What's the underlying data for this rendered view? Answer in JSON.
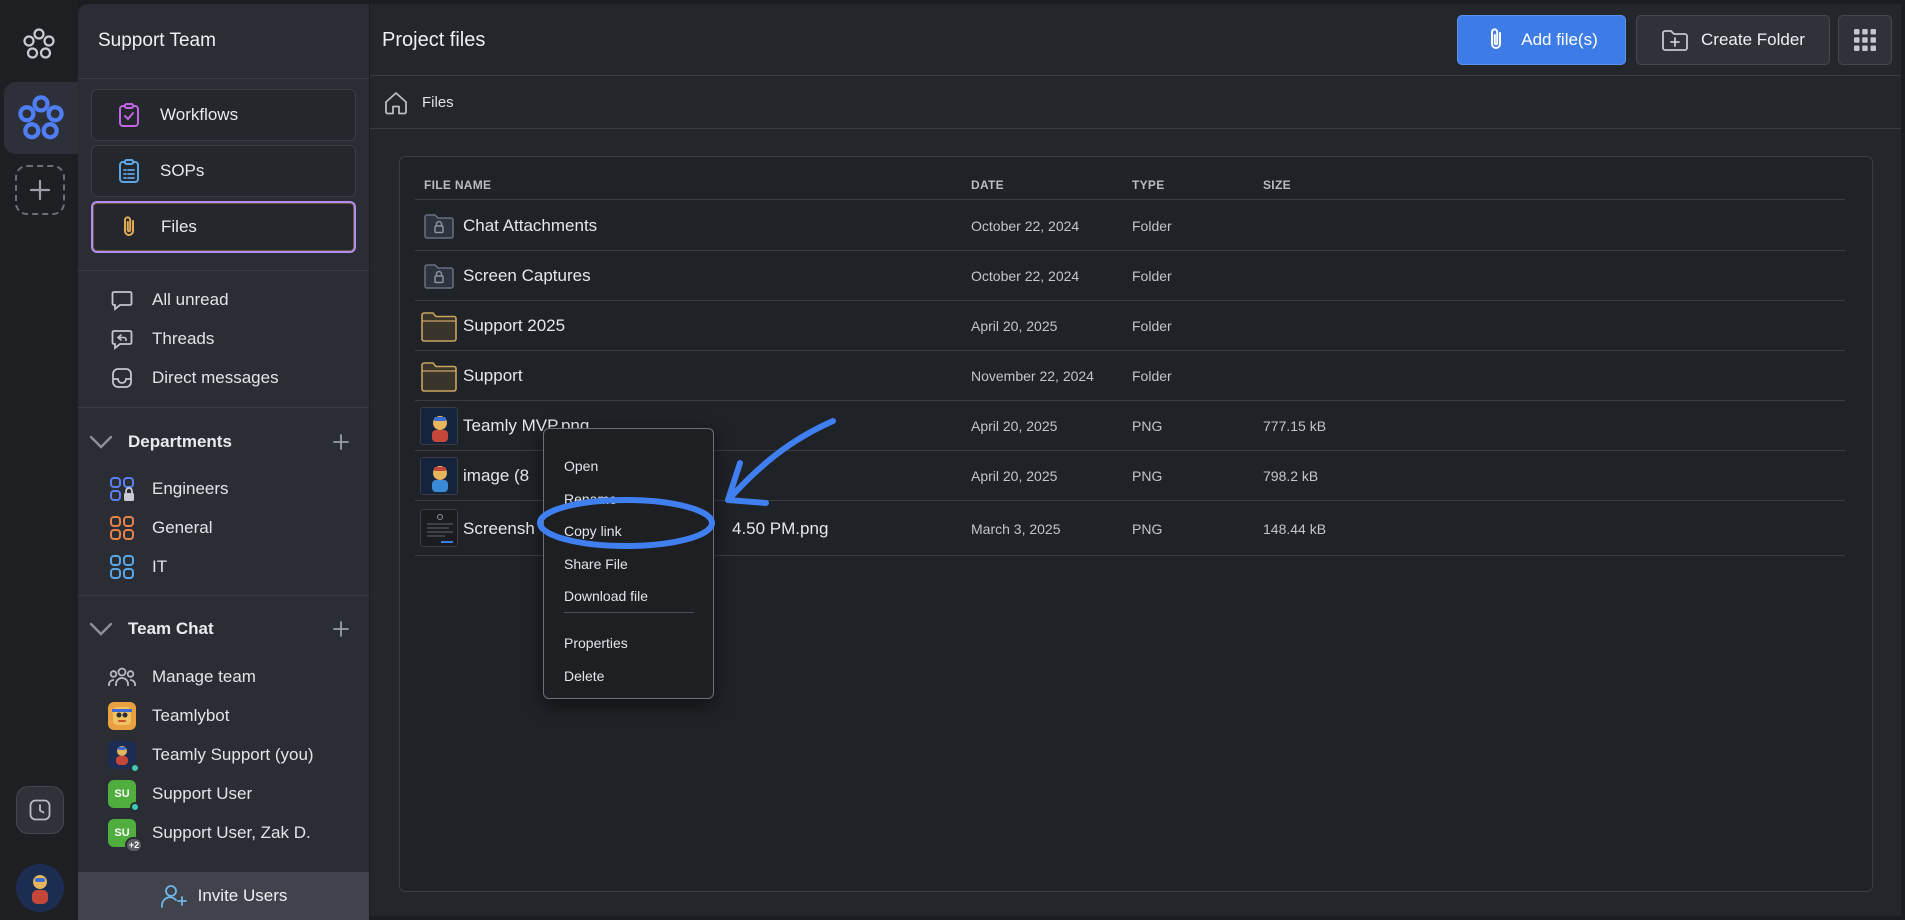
{
  "sidebar": {
    "team_name": "Support Team",
    "nav": [
      {
        "label": "Workflows",
        "icon": "clipboard-check-icon"
      },
      {
        "label": "SOPs",
        "icon": "clipboard-list-icon"
      },
      {
        "label": "Files",
        "icon": "paperclip-icon"
      }
    ],
    "quick": [
      {
        "label": "All unread",
        "icon": "chat-bubble-icon"
      },
      {
        "label": "Threads",
        "icon": "threads-icon"
      },
      {
        "label": "Direct messages",
        "icon": "inbox-icon"
      }
    ],
    "departments": {
      "title": "Departments",
      "items": [
        {
          "label": "Engineers",
          "icon": "department-locked-icon",
          "color": "#5b7ff0"
        },
        {
          "label": "General",
          "icon": "department-icon",
          "color": "#e8824a"
        },
        {
          "label": "IT",
          "icon": "department-icon",
          "color": "#5aa7e8"
        }
      ]
    },
    "team_chat": {
      "title": "Team Chat",
      "items": [
        {
          "label": "Manage team",
          "icon": "people-icon"
        },
        {
          "label": "Teamlybot",
          "icon": "bot-avatar"
        },
        {
          "label": "Teamly Support (you)",
          "icon": "support-avatar"
        },
        {
          "label": "Support User",
          "initials": "SU"
        },
        {
          "label": "Support User, Zak D.",
          "initials": "SU",
          "extra": "+2"
        }
      ]
    },
    "invite_label": "Invite Users"
  },
  "header": {
    "title": "Project files",
    "add_files_label": "Add file(s)",
    "create_folder_label": "Create Folder"
  },
  "breadcrumb": {
    "current": "Files"
  },
  "table": {
    "columns": {
      "name": "FILE NAME",
      "date": "DATE",
      "type": "TYPE",
      "size": "SIZE"
    },
    "rows": [
      {
        "name": "Chat Attachments",
        "date": "October 22, 2024",
        "type": "Folder",
        "size": "",
        "icon": "locked-folder-icon"
      },
      {
        "name": "Screen Captures",
        "date": "October 22, 2024",
        "type": "Folder",
        "size": "",
        "icon": "locked-folder-icon"
      },
      {
        "name": "Support 2025",
        "date": "April 20, 2025",
        "type": "Folder",
        "size": "",
        "icon": "folder-icon"
      },
      {
        "name": "Support",
        "date": "November 22, 2024",
        "type": "Folder",
        "size": "",
        "icon": "folder-icon"
      },
      {
        "name": "Teamly MVP.png",
        "date": "April 20, 2025",
        "type": "PNG",
        "size": "777.15 kB",
        "icon": "image-thumbnail"
      },
      {
        "name": "image (8",
        "date": "April 20, 2025",
        "type": "PNG",
        "size": "798.2 kB",
        "icon": "image-thumbnail"
      },
      {
        "name": "Screensh",
        "name_tail": "4.50 PM.png",
        "date": "March 3, 2025",
        "type": "PNG",
        "size": "148.44 kB",
        "icon": "screenshot-thumbnail"
      }
    ]
  },
  "context_menu": {
    "items": [
      "Open",
      "Rename",
      "Copy link",
      "Share File",
      "Download file",
      "Properties",
      "Delete"
    ],
    "highlighted": "Copy link"
  },
  "colors": {
    "accent_blue": "#3d7ce6",
    "annotation_blue": "#3f7ff0",
    "active_border": "#b58cf0",
    "folder_gold": "#c9a560"
  }
}
